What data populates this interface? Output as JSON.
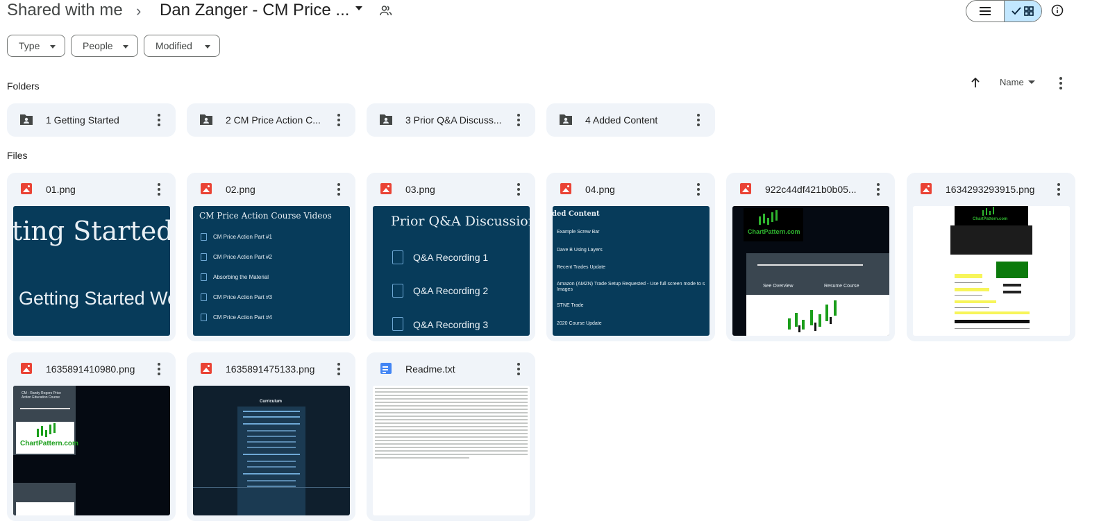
{
  "breadcrumb": {
    "root": "Shared with me",
    "separator": "›",
    "current": "Dan Zanger - CM Price ..."
  },
  "filters": {
    "type": "Type",
    "people": "People",
    "modified": "Modified"
  },
  "sections": {
    "folders": "Folders",
    "files": "Files"
  },
  "sort": {
    "label": "Name"
  },
  "folders": [
    {
      "name": "1 Getting Started"
    },
    {
      "name": "2 CM Price Action C..."
    },
    {
      "name": "3 Prior Q&A Discuss..."
    },
    {
      "name": "4 Added Content"
    }
  ],
  "files": [
    {
      "name": "01.png",
      "type": "image"
    },
    {
      "name": "02.png",
      "type": "image"
    },
    {
      "name": "03.png",
      "type": "image"
    },
    {
      "name": "04.png",
      "type": "image"
    },
    {
      "name": "922c44df421b0b05...",
      "type": "image"
    },
    {
      "name": "1634293293915.png",
      "type": "image"
    },
    {
      "name": "1635891410980.png",
      "type": "image"
    },
    {
      "name": "1635891475133.png",
      "type": "image"
    },
    {
      "name": "Readme.txt",
      "type": "document"
    }
  ],
  "thumbnails": {
    "t01": {
      "line1": "ting Started",
      "line2": "Getting Started We"
    },
    "t02": {
      "title": "CM Price Action Course Videos",
      "items": [
        "CM Price Action Part #1",
        "CM Price Action Part #2",
        "Absorbing the Material",
        "CM Price Action Part #3",
        "CM Price Action Part #4"
      ]
    },
    "t03": {
      "title": "Prior Q&A Discussions",
      "items": [
        "Q&A Recording 1",
        "Q&A Recording 2",
        "Q&A Recording 3"
      ]
    },
    "t04": {
      "title": "ded Content",
      "items": [
        "Example Screw Bar",
        "Dave B Using Layers",
        "Recent Trades Update",
        "Amazon (AMZN) Trade Setup Requested - Use full screen mode to s",
        "Images",
        "STNE Trade",
        "2020 Course Update"
      ]
    },
    "t05": {
      "brand": "ChartPattern.com",
      "left": "See Overview",
      "right": "Resume Course"
    },
    "t06": {
      "brand": "ChartPattern.com"
    },
    "t07": {
      "title": "CM - Randy Rogers Price Action Education Course",
      "brand": "ChartPattern.com"
    },
    "t08": {
      "title": "Curriculum"
    }
  },
  "colors": {
    "chip_bg": "#f0f4f9",
    "toggle_active": "#c2e7ff",
    "image_icon": "#ea4335",
    "doc_icon": "#4285f4",
    "thumb_blue": "#073b5a"
  },
  "icons": {
    "people": "people-icon",
    "list_view": "list-view-icon",
    "grid_view": "grid-view-icon",
    "info": "info-icon",
    "folder": "shared-folder-icon",
    "image": "image-file-icon",
    "doc": "doc-file-icon"
  }
}
